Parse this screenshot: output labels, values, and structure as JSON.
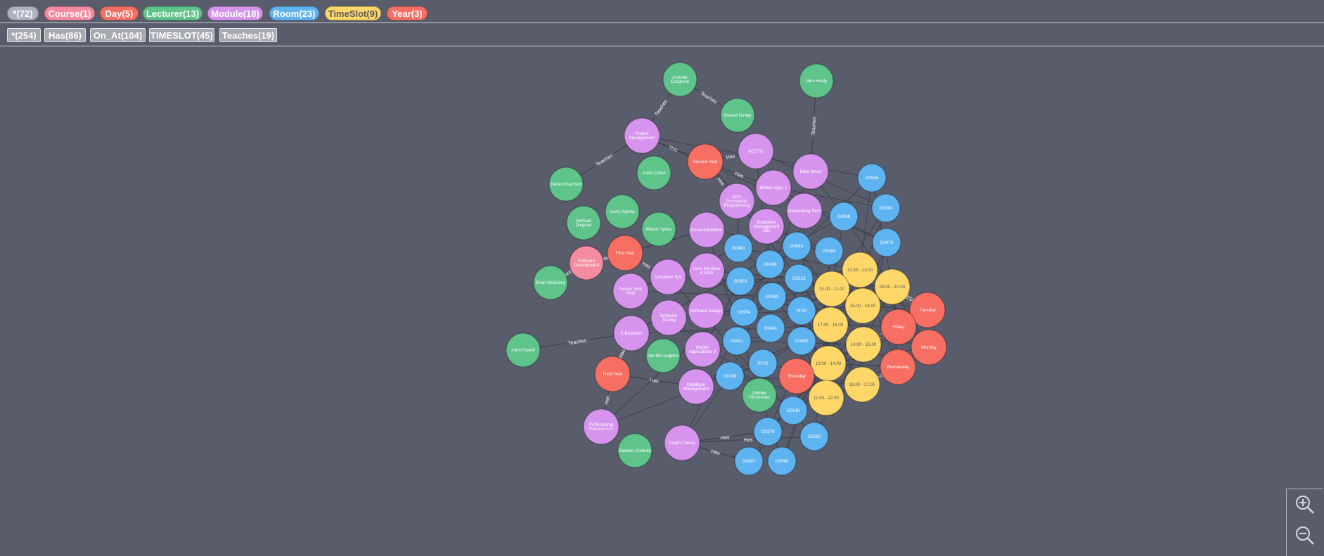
{
  "labels": [
    {
      "text": "*(72)",
      "color": "#aeb2c0",
      "text_color": "#ffffff"
    },
    {
      "text": "Course(1)",
      "color": "#f58ba1",
      "text_color": "#ffffff"
    },
    {
      "text": "Day(5)",
      "color": "#f76e63",
      "text_color": "#ffffff"
    },
    {
      "text": "Lecturer(13)",
      "color": "#5fc48a",
      "text_color": "#ffffff"
    },
    {
      "text": "Module(18)",
      "color": "#d794ee",
      "text_color": "#ffffff"
    },
    {
      "text": "Room(23)",
      "color": "#5eb4f1",
      "text_color": "#ffffff"
    },
    {
      "text": "TimeSlot(9)",
      "color": "#fdd768",
      "text_color": "#5a5a5a"
    },
    {
      "text": "Year(3)",
      "color": "#f76e63",
      "text_color": "#ffffff"
    }
  ],
  "relationship_types": [
    {
      "text": "*(254)"
    },
    {
      "text": "Has(86)"
    },
    {
      "text": "On_At(104)"
    },
    {
      "text": "TIMESLOT(45)"
    },
    {
      "text": "Teaches(19)"
    }
  ],
  "node_colors": {
    "Lecturer": "#5fc48a",
    "Module": "#d794ee",
    "Room": "#5eb4f1",
    "TimeSlot": "#fdd768",
    "Day": "#f76e63",
    "Year": "#f76e63",
    "Course": "#f58ba1"
  },
  "nodes": [
    {
      "id": "annette",
      "label": "Lecturer",
      "lines": [
        "Annette",
        "Cosgrove"
      ]
    },
    {
      "id": "john_healy",
      "label": "Lecturer",
      "lines": [
        "John Healy"
      ]
    },
    {
      "id": "gerard_hurley",
      "label": "Lecturer",
      "lines": [
        "Gerard Hurley"
      ]
    },
    {
      "id": "proj_mgmt",
      "label": "Module",
      "lines": [
        "Project",
        "Management"
      ]
    },
    {
      "id": "acctg",
      "label": "Module",
      "lines": [
        "ACCTG"
      ]
    },
    {
      "id": "second_year",
      "label": "Year",
      "lines": [
        "Second Year"
      ]
    },
    {
      "id": "data_struct",
      "label": "Module",
      "lines": [
        "Data Struct"
      ]
    },
    {
      "id": "g0836",
      "label": "Room",
      "lines": [
        "G0836"
      ]
    },
    {
      "id": "aoife",
      "label": "Lecturer",
      "lines": [
        "Aoife Clifton"
      ]
    },
    {
      "id": "mobile_apps1",
      "label": "Module",
      "lines": [
        "Mobile Apps 1"
      ]
    },
    {
      "id": "gerard_harrison",
      "label": "Lecturer",
      "lines": [
        "Gerard Harrison"
      ]
    },
    {
      "id": "adv_proc",
      "label": "Module",
      "lines": [
        "ADV.",
        "Procedural",
        "Programming"
      ]
    },
    {
      "id": "g0384",
      "label": "Room",
      "lines": [
        "G0384"
      ]
    },
    {
      "id": "garry",
      "label": "Lecturer",
      "lines": [
        "Garry Agnew"
      ]
    },
    {
      "id": "networking",
      "label": "Module",
      "lines": [
        "Networking Tech"
      ]
    },
    {
      "id": "g0998",
      "label": "Room",
      "lines": [
        "G0998"
      ]
    },
    {
      "id": "michael",
      "label": "Lecturer",
      "lines": [
        "Michael",
        "Duignan"
      ]
    },
    {
      "id": "martin",
      "label": "Lecturer",
      "lines": [
        "Martin Hynes"
      ]
    },
    {
      "id": "essential_maths",
      "label": "Module",
      "lines": [
        "Essential Maths"
      ]
    },
    {
      "id": "db_mgmt_1n2",
      "label": "Module",
      "lines": [
        "Database",
        "Management",
        "1N2"
      ]
    },
    {
      "id": "g0478",
      "label": "Room",
      "lines": [
        "G0478"
      ]
    },
    {
      "id": "g0490",
      "label": "Room",
      "lines": [
        "G0490"
      ]
    },
    {
      "id": "g0940",
      "label": "Room",
      "lines": [
        "G0940"
      ]
    },
    {
      "id": "g0484",
      "label": "Room",
      "lines": [
        "G0484"
      ]
    },
    {
      "id": "first_year",
      "label": "Year",
      "lines": [
        "First Year"
      ]
    },
    {
      "id": "software_dev",
      "label": "Course",
      "lines": [
        "Software",
        "Development"
      ]
    },
    {
      "id": "ts_12",
      "label": "TimeSlot",
      "lines": [
        "12.00 - 13.00"
      ]
    },
    {
      "id": "g0438",
      "label": "Room",
      "lines": [
        "G0438"
      ]
    },
    {
      "id": "ui_web",
      "label": "Module",
      "lines": [
        "User Interface",
        "& Web"
      ]
    },
    {
      "id": "comp_sys",
      "label": "Module",
      "lines": [
        "Computer Sys"
      ]
    },
    {
      "id": "brian",
      "label": "Lecturer",
      "lines": [
        "Brian McGinley"
      ]
    },
    {
      "id": "g0223",
      "label": "Room",
      "lines": [
        "G0223"
      ]
    },
    {
      "id": "g0953",
      "label": "Room",
      "lines": [
        "G0953"
      ]
    },
    {
      "id": "ts_10",
      "label": "TimeSlot",
      "lines": [
        "10.00 - 11.00"
      ]
    },
    {
      "id": "ts_09",
      "label": "TimeSlot",
      "lines": [
        "09.00 - 10.00"
      ]
    },
    {
      "id": "server_side",
      "label": "Module",
      "lines": [
        "Server Side",
        "RAD"
      ]
    },
    {
      "id": "g0483",
      "label": "Room",
      "lines": [
        "G0483"
      ]
    },
    {
      "id": "ts_15",
      "label": "TimeSlot",
      "lines": [
        "15.00 - 16.00"
      ]
    },
    {
      "id": "tuesday",
      "label": "Day",
      "lines": [
        "Tuesday"
      ]
    },
    {
      "id": "software_design",
      "label": "Module",
      "lines": [
        "Software Design"
      ]
    },
    {
      "id": "g0994",
      "label": "Room",
      "lines": [
        "G0994"
      ]
    },
    {
      "id": "pf10",
      "label": "Room",
      "lines": [
        "PF10"
      ]
    },
    {
      "id": "software_testing",
      "label": "Module",
      "lines": [
        "Software",
        "Testing"
      ]
    },
    {
      "id": "ts_17",
      "label": "TimeSlot",
      "lines": [
        "17.00 - 18.00"
      ]
    },
    {
      "id": "friday",
      "label": "Day",
      "lines": [
        "Friday"
      ]
    },
    {
      "id": "g0481",
      "label": "Room",
      "lines": [
        "G0481"
      ]
    },
    {
      "id": "ebusiness",
      "label": "Module",
      "lines": [
        "E-Business"
      ]
    },
    {
      "id": "john_fawell",
      "label": "Lecturer",
      "lines": [
        "John Fawell"
      ]
    },
    {
      "id": "g0941",
      "label": "Room",
      "lines": [
        "G0941"
      ]
    },
    {
      "id": "g0482",
      "label": "Room",
      "lines": [
        "G0482"
      ]
    },
    {
      "id": "ts_14",
      "label": "TimeSlot",
      "lines": [
        "14.00 - 15.00"
      ]
    },
    {
      "id": "monday",
      "label": "Day",
      "lines": [
        "Monday"
      ]
    },
    {
      "id": "ian",
      "label": "Lecturer",
      "lines": [
        "Ian McLoughlin"
      ]
    },
    {
      "id": "mobile_apps2",
      "label": "Module",
      "lines": [
        "Mobile",
        "Applications 2"
      ]
    },
    {
      "id": "pf02",
      "label": "Room",
      "lines": [
        "PF02"
      ]
    },
    {
      "id": "ts_13",
      "label": "TimeSlot",
      "lines": [
        "13.00 - 14.00"
      ]
    },
    {
      "id": "wednesday",
      "label": "Day",
      "lines": [
        "Wednesday"
      ]
    },
    {
      "id": "third_year",
      "label": "Year",
      "lines": [
        "Third Year"
      ]
    },
    {
      "id": "g0208",
      "label": "Room",
      "lines": [
        "G0208"
      ]
    },
    {
      "id": "thursday",
      "label": "Day",
      "lines": [
        "Thursday"
      ]
    },
    {
      "id": "db_mgmt",
      "label": "Module",
      "lines": [
        "Database",
        "Management"
      ]
    },
    {
      "id": "ts_16",
      "label": "TimeSlot",
      "lines": [
        "16.00 - 17.00"
      ]
    },
    {
      "id": "debbie",
      "label": "Lecturer",
      "lines": [
        "Debbie",
        "ODonovan"
      ]
    },
    {
      "id": "ts_11",
      "label": "TimeSlot",
      "lines": [
        "11.00 - 12.00"
      ]
    },
    {
      "id": "g0145",
      "label": "Room",
      "lines": [
        "G0145"
      ]
    },
    {
      "id": "prof_practice",
      "label": "Module",
      "lines": [
        "Professional",
        "Practice in IT"
      ]
    },
    {
      "id": "g0379",
      "label": "Room",
      "lines": [
        "G0379"
      ]
    },
    {
      "id": "g0182",
      "label": "Room",
      "lines": [
        "G0182"
      ]
    },
    {
      "id": "graph_theory",
      "label": "Module",
      "lines": [
        "Graph Theory"
      ]
    },
    {
      "id": "damien",
      "label": "Lecturer",
      "lines": [
        "Damien Costello"
      ]
    },
    {
      "id": "g0987",
      "label": "Room",
      "lines": [
        "G0987"
      ]
    },
    {
      "id": "g0990",
      "label": "Room",
      "lines": [
        "G0990"
      ]
    }
  ],
  "relationships": [
    {
      "from": "annette",
      "to": "proj_mgmt",
      "type": "Teaches"
    },
    {
      "from": "annette",
      "to": "gerard_hurley",
      "type": "Teaches"
    },
    {
      "from": "john_healy",
      "to": "data_struct",
      "type": "Teaches"
    },
    {
      "from": "gerard_harrison",
      "to": "proj_mgmt",
      "type": "Teaches"
    },
    {
      "from": "brian",
      "to": "software_dev",
      "type": "Teaches"
    },
    {
      "from": "john_fawell",
      "to": "ebusiness",
      "type": "Teaches"
    },
    {
      "from": "second_year",
      "to": "acctg",
      "type": "Has"
    },
    {
      "from": "second_year",
      "to": "proj_mgmt",
      "type": "Has"
    },
    {
      "from": "second_year",
      "to": "mobile_apps1",
      "type": "Has"
    },
    {
      "from": "second_year",
      "to": "adv_proc",
      "type": "Has"
    },
    {
      "from": "second_year",
      "to": "db_mgmt_1n2",
      "type": "Has"
    },
    {
      "from": "first_year",
      "to": "software_dev",
      "type": "Has"
    },
    {
      "from": "first_year",
      "to": "comp_sys",
      "type": "Has"
    },
    {
      "from": "first_year",
      "to": "essential_maths",
      "type": "Has"
    },
    {
      "from": "third_year",
      "to": "ebusiness",
      "type": "Has"
    },
    {
      "from": "third_year",
      "to": "prof_practice",
      "type": "Has"
    },
    {
      "from": "third_year",
      "to": "db_mgmt",
      "type": "Has"
    },
    {
      "from": "graph_theory",
      "to": "g0987",
      "type": "Has"
    },
    {
      "from": "graph_theory",
      "to": "g0379",
      "type": "Has"
    },
    {
      "from": "graph_theory",
      "to": "g0182",
      "type": "Has"
    },
    {
      "from": "ts_16",
      "to": "wednesday",
      "type": "TIMESLOT"
    },
    {
      "from": "ts_09",
      "to": "tuesday",
      "type": "TIMESLOT"
    },
    {
      "from": "ts_14",
      "to": "friday",
      "type": "TIMESLOT"
    }
  ],
  "zoom": {
    "in_icon": "zoom-in-icon",
    "out_icon": "zoom-out-icon"
  }
}
